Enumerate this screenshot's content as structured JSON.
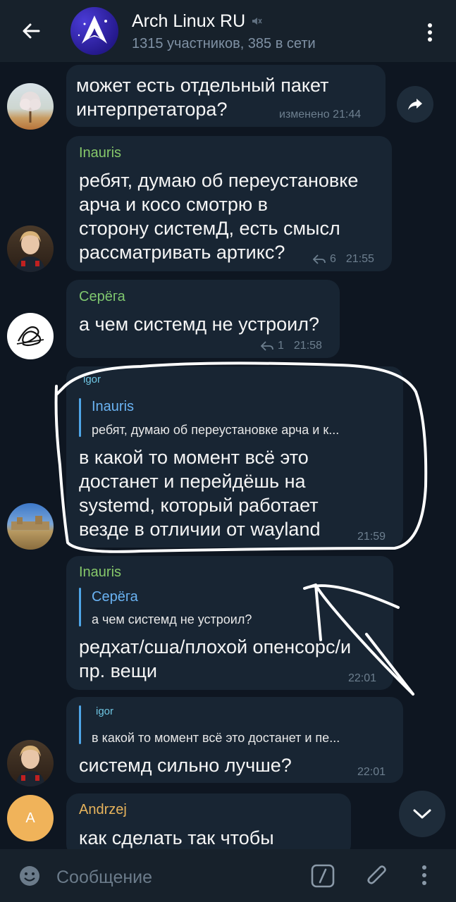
{
  "header": {
    "title": "Arch Linux RU",
    "subtitle": "1315 участников, 385 в сети"
  },
  "messages": [
    {
      "id": "m1",
      "text_lines": [
        "может есть отдельный пакет",
        "интерпретатора?"
      ],
      "time": "изменено 21:44"
    },
    {
      "id": "m2",
      "sender": "Inauris",
      "text_lines": [
        "ребят, думаю об переустановке",
        "арча и косо смотрю в",
        "сторону системД, есть смысл",
        "рассматривать артикс?"
      ],
      "replies": "6",
      "time": "21:55"
    },
    {
      "id": "m3",
      "sender": "Серёга",
      "text_lines": [
        "а чем системд не устроил?"
      ],
      "replies": "1",
      "time": "21:58"
    },
    {
      "id": "m4",
      "sender": "igor",
      "reply_name": "Inauris",
      "reply_text": "ребят, думаю об переустановке арча и к...",
      "text_lines": [
        "в какой то момент всё это",
        "достанет и перейдёшь на",
        "systemd, который работает",
        "везде в отличии от wayland"
      ],
      "time": "21:59"
    },
    {
      "id": "m5",
      "sender": "Inauris",
      "reply_name": "Серёга",
      "reply_text": "а чем системд не устроил?",
      "text_lines": [
        "редхат/сша/плохой опенсорс/и",
        "пр. вещи"
      ],
      "time": "22:01"
    },
    {
      "id": "m6",
      "reply_name": "igor",
      "reply_text": "в какой то момент всё это достанет и пе...",
      "text_lines": [
        "системд сильно лучше?"
      ],
      "time": "22:01"
    },
    {
      "id": "m7",
      "sender": "Andrzej",
      "avatar_letter": "A",
      "text_lines": [
        "как сделать так чтобы"
      ]
    }
  ],
  "input": {
    "placeholder": "Сообщение"
  },
  "colors": {
    "background": "#0e1621",
    "header": "#17212b",
    "bubble": "#182533",
    "sender_inauris": "#86c86a",
    "sender_serega": "#7fc76f",
    "sender_igor": "#6fc6e3",
    "sender_andrzej": "#e6b35c",
    "reply_accent": "#4fa6e8"
  },
  "icons": [
    "back-arrow-icon",
    "muted-icon",
    "more-vert-icon",
    "share-icon",
    "reply-icon",
    "chevron-down-icon",
    "emoji-icon",
    "bot-command-icon",
    "attach-icon"
  ]
}
